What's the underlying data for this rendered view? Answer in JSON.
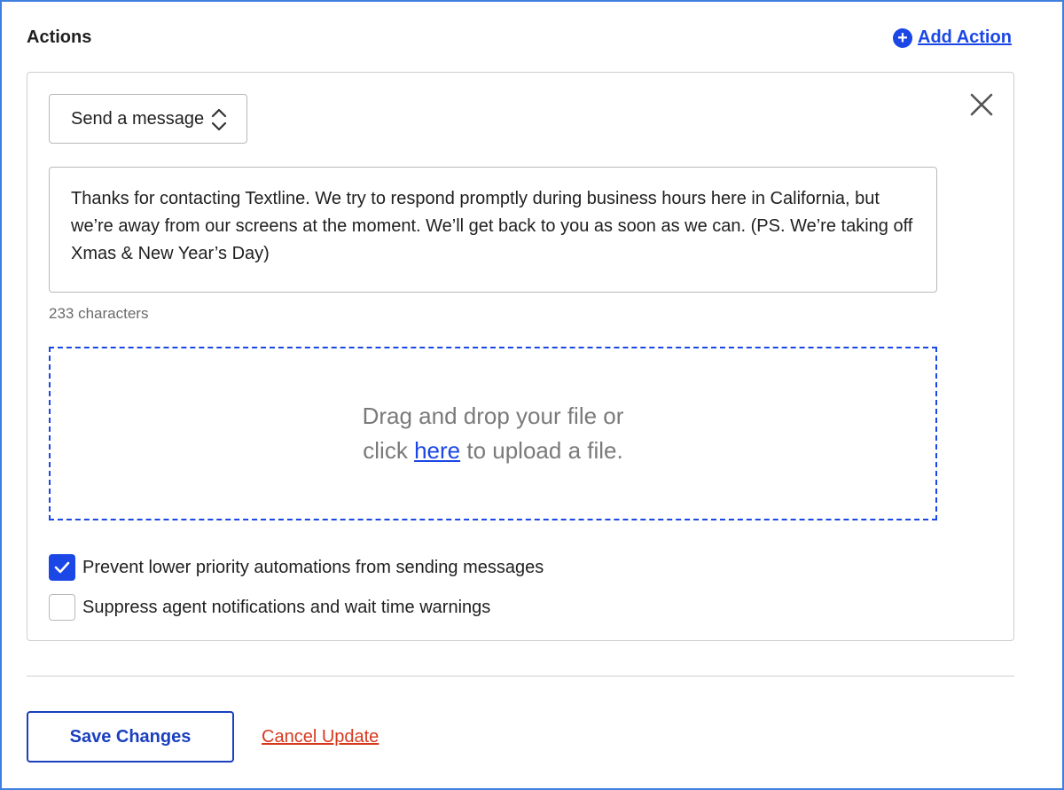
{
  "section": {
    "title": "Actions",
    "add_action_label": "Add Action"
  },
  "action": {
    "type_selected": "Send a message",
    "message_text": "Thanks for contacting Textline. We try to respond promptly during business hours here in California, but we’re away from our screens at the moment. We’ll get back to you as soon as we can. (PS. We’re taking off Xmas & New Year’s Day)",
    "char_count": "233 characters",
    "upload": {
      "line1": "Drag and drop your file or",
      "line2_prefix": "click",
      "link": "here",
      "line2_suffix": "to upload a file."
    },
    "options": [
      {
        "label": "Prevent lower priority automations from sending messages",
        "checked": true
      },
      {
        "label": "Suppress agent notifications and wait time warnings",
        "checked": false
      }
    ]
  },
  "footer": {
    "save_label": "Save Changes",
    "cancel_label": "Cancel Update"
  },
  "colors": {
    "accent": "#1a47e5",
    "cancel": "#d8391e",
    "frame_border": "#3f7fe0"
  }
}
